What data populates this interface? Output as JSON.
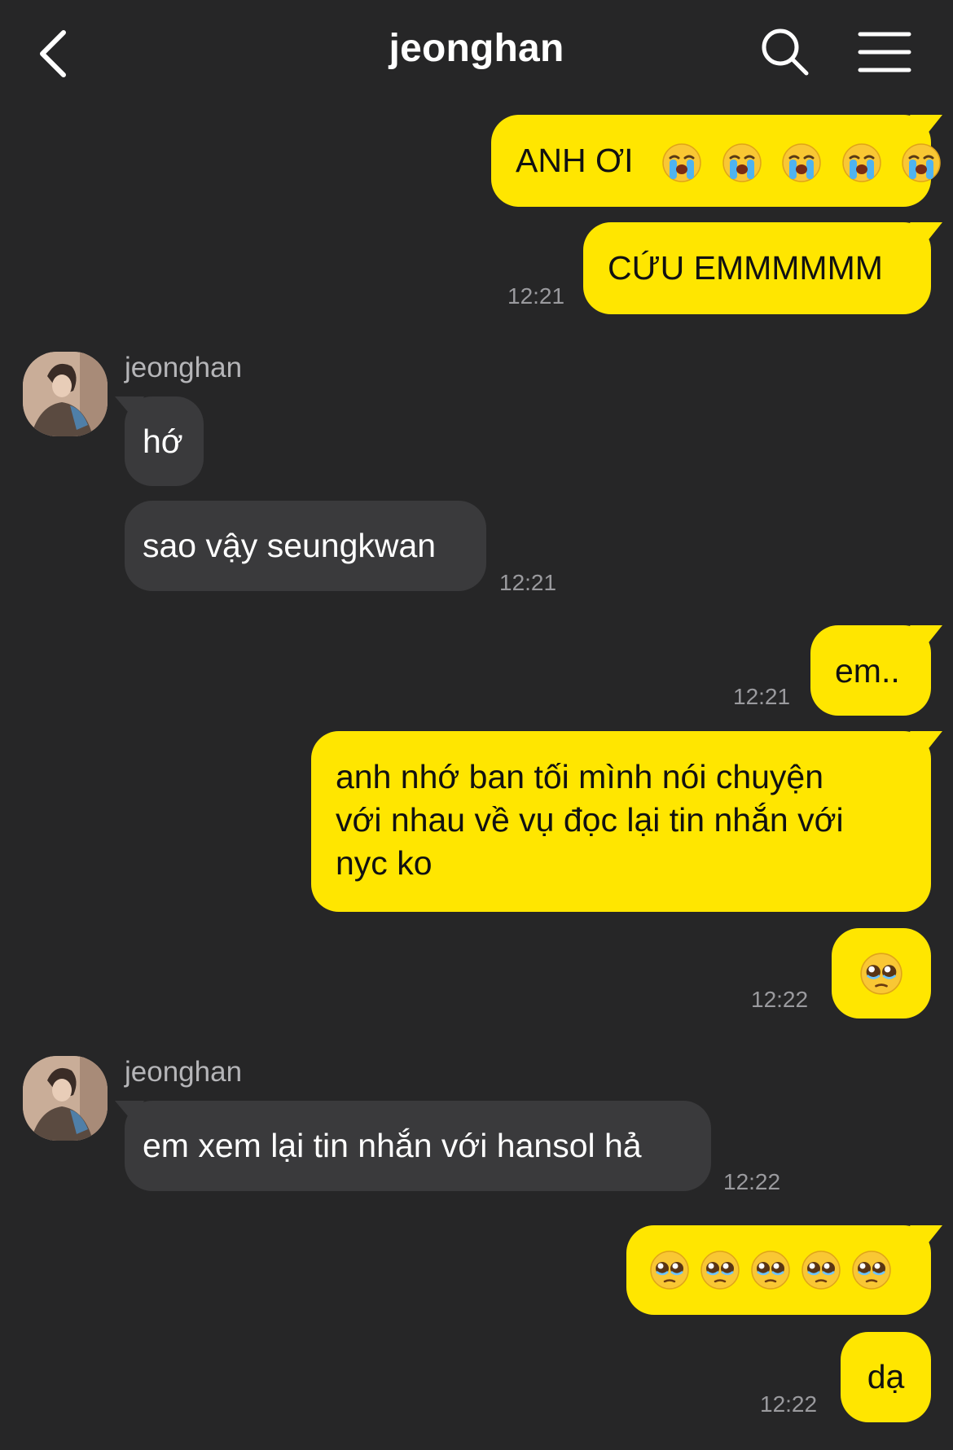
{
  "header": {
    "title": "jeonghan"
  },
  "messages": {
    "m1": {
      "text": "ANH ƠI",
      "emoji_count": 5,
      "emoji": "loudly-crying-face"
    },
    "m2": {
      "text": "CỨU EMMMMMM",
      "time": "12:21"
    },
    "g1": {
      "sender": "jeonghan"
    },
    "m3": {
      "text": "hớ"
    },
    "m4": {
      "text": "sao vậy seungkwan",
      "time": "12:21"
    },
    "m5": {
      "text": "em..",
      "time": "12:21"
    },
    "m6": {
      "lines": [
        "anh nhớ ban tối mình nói chuyện",
        "với nhau về vụ đọc lại tin nhắn với",
        "nyc ko"
      ]
    },
    "m7": {
      "emoji_count": 1,
      "emoji": "pleading-face",
      "time": "12:22"
    },
    "g2": {
      "sender": "jeonghan"
    },
    "m8": {
      "text": "em xem lại tin nhắn với hansol hả",
      "time": "12:22"
    },
    "m9": {
      "emoji_count": 5,
      "emoji": "pleading-face"
    },
    "m10": {
      "text": "dạ",
      "time": "12:22"
    }
  },
  "colors": {
    "background": "#262627",
    "my_bubble": "#FFE600",
    "their_bubble": "#3A3A3C",
    "timestamp": "#9a9a9e"
  }
}
